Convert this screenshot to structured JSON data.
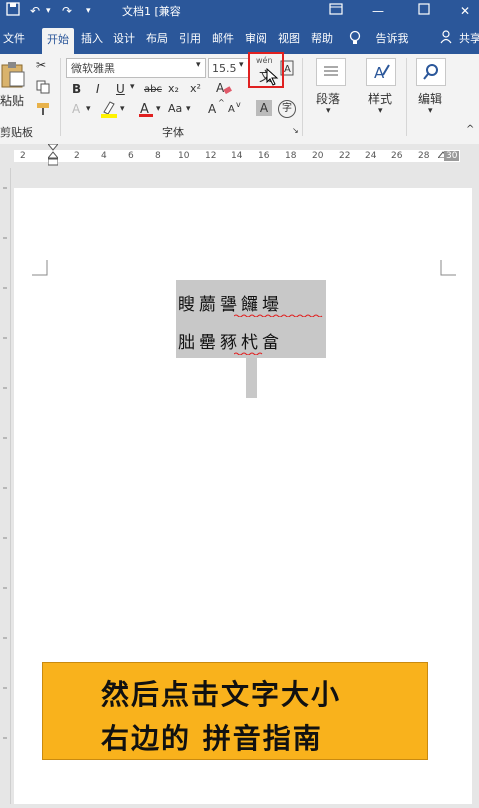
{
  "titlebar": {
    "title": "文档1 [兼容",
    "save_icon": "save-icon",
    "undo_icon": "undo-icon",
    "redo_icon": "redo-icon"
  },
  "tabs": [
    {
      "label": "文件"
    },
    {
      "label": "开始"
    },
    {
      "label": "插入"
    },
    {
      "label": "设计"
    },
    {
      "label": "布局"
    },
    {
      "label": "引用"
    },
    {
      "label": "邮件"
    },
    {
      "label": "审阅"
    },
    {
      "label": "视图"
    },
    {
      "label": "帮助"
    }
  ],
  "tell_me": "告诉我",
  "share": "共享",
  "ribbon": {
    "paste_label": "粘贴",
    "clipboard_label": "剪贴板",
    "font_name": "微软雅黑",
    "font_size": "15.5",
    "font_group_label": "字体",
    "phonetic_top": "wén",
    "phonetic_char": "文",
    "bold": "B",
    "italic": "I",
    "underline": "U",
    "strike": "abc",
    "subscript": "x₂",
    "superscript": "x²",
    "font_color_A": "A",
    "change_case": "Aa",
    "grow": "A",
    "shrink": "A",
    "char_shading": "A",
    "enclose": "字",
    "paragraph_label": "段落",
    "styles_label": "样式",
    "editing_label": "编辑"
  },
  "ruler": {
    "ticks": [
      "2",
      "2",
      "4",
      "6",
      "8",
      "10",
      "12",
      "14",
      "16",
      "18",
      "20",
      "22",
      "24",
      "26",
      "28",
      "30"
    ]
  },
  "document": {
    "line1": "瞍蘮謽饠壜",
    "line2": "胐罍豩杙畣"
  },
  "banner": {
    "line1": "然后点击文字大小",
    "line2": "右边的 拼音指南"
  },
  "colors": {
    "accent": "#2b579a",
    "highlight_red": "#e02020",
    "banner_bg": "#f9b21c"
  }
}
